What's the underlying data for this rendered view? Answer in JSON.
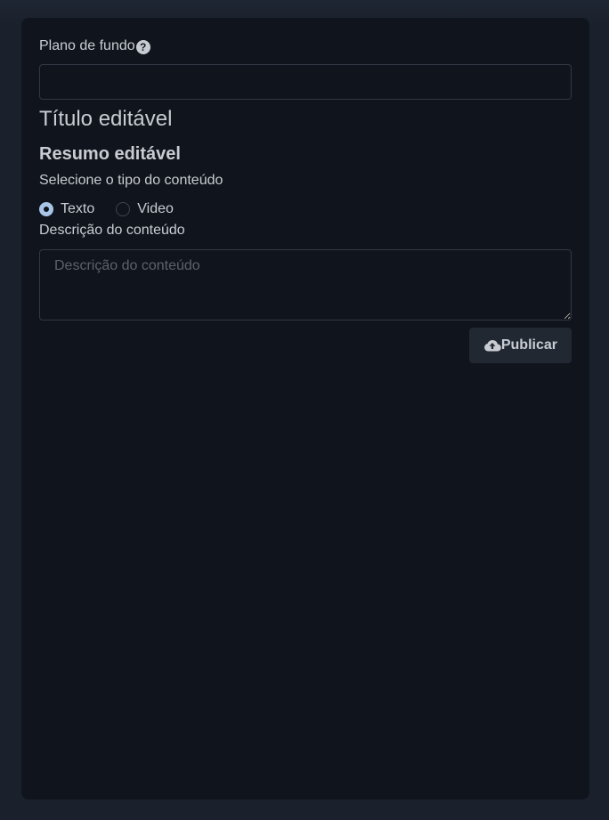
{
  "form": {
    "background_label": "Plano de fundo",
    "help_glyph": "?",
    "title": "Título editável",
    "summary": "Resumo editável",
    "content_type_label": "Selecione o tipo do conteúdo",
    "content_types": [
      {
        "label": "Texto",
        "selected": true
      },
      {
        "label": "Video",
        "selected": false
      }
    ],
    "description_label": "Descrição do conteúdo",
    "description_placeholder": "Descrição do conteúdo",
    "publish_label": "Publicar"
  },
  "colors": {
    "page_background": "#1a212c",
    "card_background": "#10151d",
    "text": "#c8ccd2",
    "radio_accent": "#a9c6e8",
    "button_background": "#222832"
  }
}
